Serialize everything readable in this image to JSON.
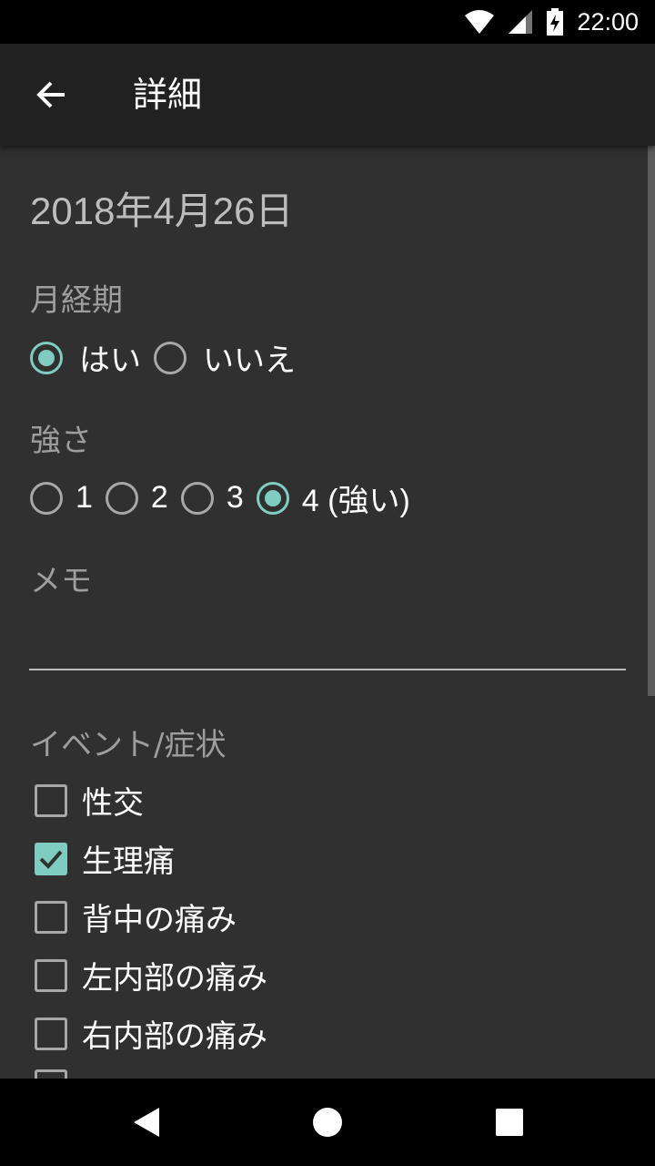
{
  "status_bar": {
    "time": "22:00",
    "icons": [
      "wifi-icon",
      "cell-signal-icon",
      "battery-charging-icon"
    ]
  },
  "app_bar": {
    "title": "詳細",
    "back_icon": "arrow-back-icon"
  },
  "date": "2018年4月26日",
  "period": {
    "label": "月経期",
    "options": [
      "はい",
      "いいえ"
    ],
    "selected": "はい"
  },
  "intensity": {
    "label": "強さ",
    "options": [
      "1",
      "2",
      "3",
      "4 (強い)"
    ],
    "selected": "4 (強い)"
  },
  "memo": {
    "label": "メモ",
    "value": ""
  },
  "events": {
    "label": "イベント/症状",
    "items": [
      {
        "label": "性交",
        "checked": false
      },
      {
        "label": "生理痛",
        "checked": true
      },
      {
        "label": "背中の痛み",
        "checked": false
      },
      {
        "label": "左内部の痛み",
        "checked": false
      },
      {
        "label": "右内部の痛み",
        "checked": false
      }
    ]
  },
  "accent_color": "#7ecdc0",
  "nav_bar": {
    "icons": [
      "back-triangle-icon",
      "home-circle-icon",
      "recents-square-icon"
    ]
  }
}
